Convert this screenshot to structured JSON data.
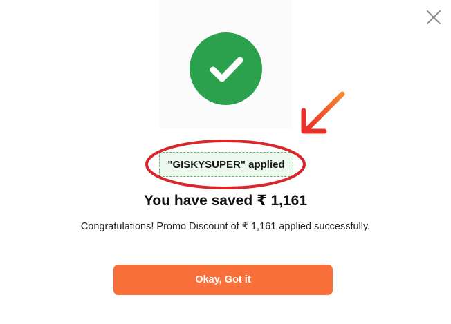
{
  "modal": {
    "promo_chip_text": "\"GISKYSUPER\" applied",
    "saved_title": "You have saved ₹ 1,161",
    "message": "Congratulations! Promo Discount of ₹ 1,161 applied successfully.",
    "ok_button_label": "Okay, Got it"
  },
  "icons": {
    "close": "close-icon",
    "success": "checkmark-icon",
    "annotation_arrow": "arrow-icon",
    "annotation_ring": "ellipse-highlight"
  },
  "colors": {
    "success_green": "#2ba14e",
    "chip_background": "#ecf8ee",
    "chip_border": "#5cb672",
    "button_orange": "#f96f3a",
    "annotation_red": "#d9262b",
    "arrow_orange": "#ef4a2a"
  }
}
